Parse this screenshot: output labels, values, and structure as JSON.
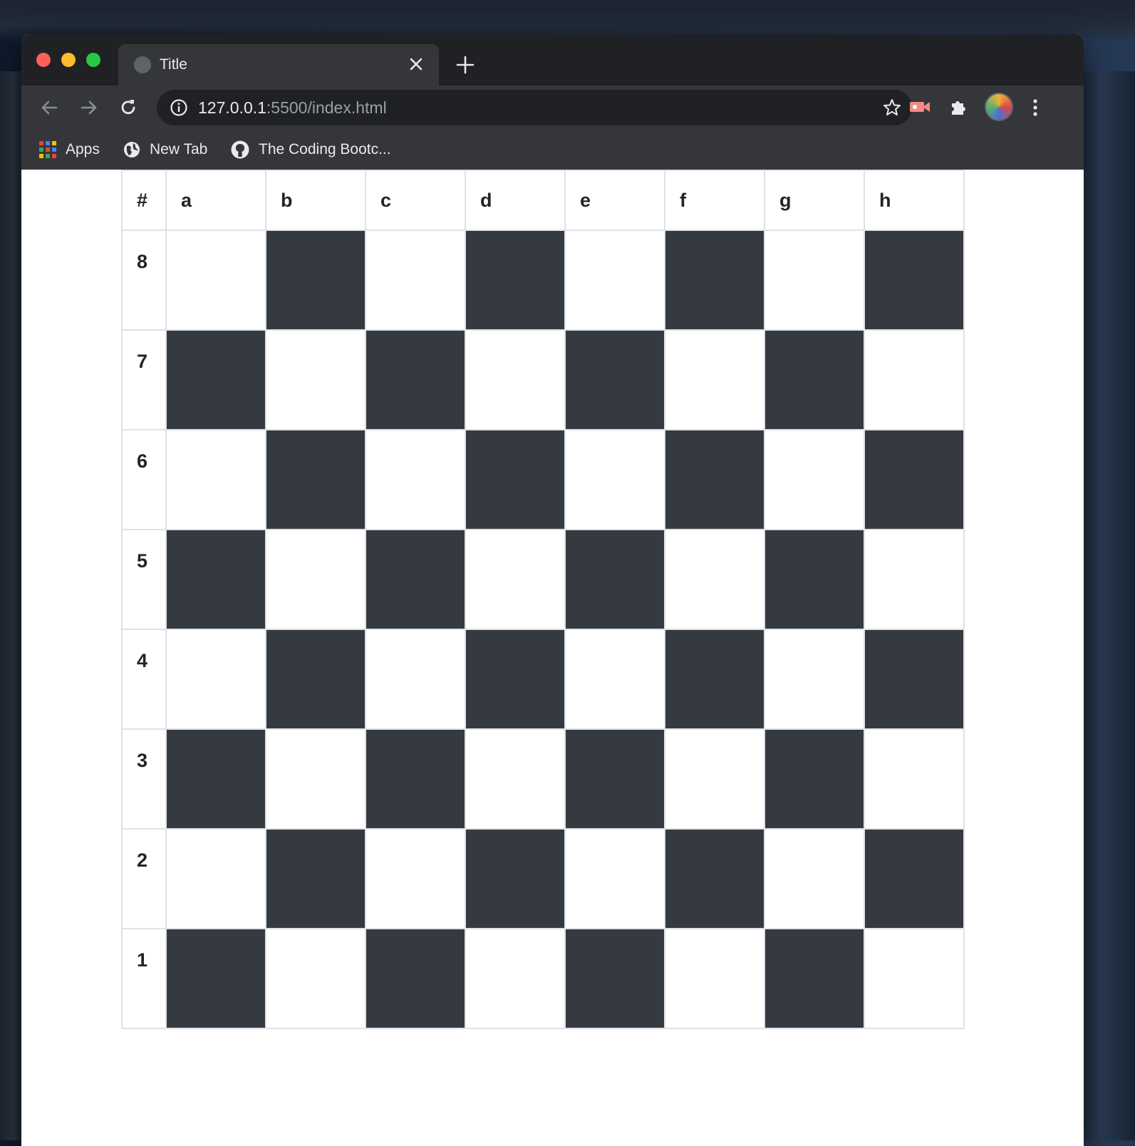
{
  "browser": {
    "tab_title": "Title",
    "url_host": "127.0.0.1",
    "url_path": ":5500/index.html",
    "bookmarks": [
      {
        "label": "Apps",
        "icon": "apps-grid-icon"
      },
      {
        "label": "New Tab",
        "icon": "globe-icon"
      },
      {
        "label": "The Coding Bootc...",
        "icon": "github-icon"
      }
    ]
  },
  "board": {
    "corner": "#",
    "files": [
      "a",
      "b",
      "c",
      "d",
      "e",
      "f",
      "g",
      "h"
    ],
    "ranks": [
      "8",
      "7",
      "6",
      "5",
      "4",
      "3",
      "2",
      "1"
    ],
    "dark_color": "#343a40",
    "light_color": "#ffffff"
  }
}
